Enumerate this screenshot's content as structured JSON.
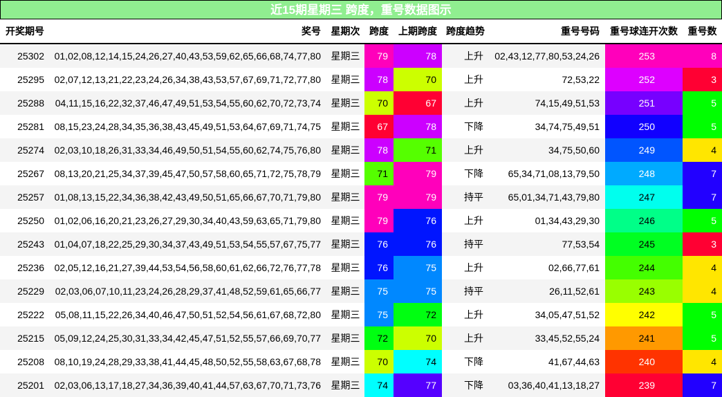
{
  "title": "近15期星期三 跨度，重号数据图示",
  "headers": [
    "开奖期号",
    "奖号",
    "星期次",
    "跨度",
    "上期跨度",
    "跨度趋势",
    "重号号码",
    "重号球连开次数",
    "重号数"
  ],
  "rows": [
    {
      "issue": "25302",
      "numbers": "01,02,08,12,14,15,24,26,27,40,43,53,59,62,65,66,68,74,77,80",
      "weekday": "星期三",
      "span": "79",
      "prev_span": "78",
      "trend": "上升",
      "repeat_numbers": "02,43,12,77,80,53,24,26",
      "streak": "253",
      "repeat_count": "8"
    },
    {
      "issue": "25295",
      "numbers": "02,07,12,13,21,22,23,24,26,34,38,43,53,57,67,69,71,72,77,80",
      "weekday": "星期三",
      "span": "78",
      "prev_span": "70",
      "trend": "上升",
      "repeat_numbers": "72,53,22",
      "streak": "252",
      "repeat_count": "3"
    },
    {
      "issue": "25288",
      "numbers": "04,11,15,16,22,32,37,46,47,49,51,53,54,55,60,62,70,72,73,74",
      "weekday": "星期三",
      "span": "70",
      "prev_span": "67",
      "trend": "上升",
      "repeat_numbers": "74,15,49,51,53",
      "streak": "251",
      "repeat_count": "5"
    },
    {
      "issue": "25281",
      "numbers": "08,15,23,24,28,34,35,36,38,43,45,49,51,53,64,67,69,71,74,75",
      "weekday": "星期三",
      "span": "67",
      "prev_span": "78",
      "trend": "下降",
      "repeat_numbers": "34,74,75,49,51",
      "streak": "250",
      "repeat_count": "5"
    },
    {
      "issue": "25274",
      "numbers": "02,03,10,18,26,31,33,34,46,49,50,51,54,55,60,62,74,75,76,80",
      "weekday": "星期三",
      "span": "78",
      "prev_span": "71",
      "trend": "上升",
      "repeat_numbers": "34,75,50,60",
      "streak": "249",
      "repeat_count": "4"
    },
    {
      "issue": "25267",
      "numbers": "08,13,20,21,25,34,37,39,45,47,50,57,58,60,65,71,72,75,78,79",
      "weekday": "星期三",
      "span": "71",
      "prev_span": "79",
      "trend": "下降",
      "repeat_numbers": "65,34,71,08,13,79,50",
      "streak": "248",
      "repeat_count": "7"
    },
    {
      "issue": "25257",
      "numbers": "01,08,13,15,22,34,36,38,42,43,49,50,51,65,66,67,70,71,79,80",
      "weekday": "星期三",
      "span": "79",
      "prev_span": "79",
      "trend": "持平",
      "repeat_numbers": "65,01,34,71,43,79,80",
      "streak": "247",
      "repeat_count": "7"
    },
    {
      "issue": "25250",
      "numbers": "01,02,06,16,20,21,23,26,27,29,30,34,40,43,59,63,65,71,79,80",
      "weekday": "星期三",
      "span": "79",
      "prev_span": "76",
      "trend": "上升",
      "repeat_numbers": "01,34,43,29,30",
      "streak": "246",
      "repeat_count": "5"
    },
    {
      "issue": "25243",
      "numbers": "01,04,07,18,22,25,29,30,34,37,43,49,51,53,54,55,57,67,75,77",
      "weekday": "星期三",
      "span": "76",
      "prev_span": "76",
      "trend": "持平",
      "repeat_numbers": "77,53,54",
      "streak": "245",
      "repeat_count": "3"
    },
    {
      "issue": "25236",
      "numbers": "02,05,12,16,21,27,39,44,53,54,56,58,60,61,62,66,72,76,77,78",
      "weekday": "星期三",
      "span": "76",
      "prev_span": "75",
      "trend": "上升",
      "repeat_numbers": "02,66,77,61",
      "streak": "244",
      "repeat_count": "4"
    },
    {
      "issue": "25229",
      "numbers": "02,03,06,07,10,11,23,24,26,28,29,37,41,48,52,59,61,65,66,77",
      "weekday": "星期三",
      "span": "75",
      "prev_span": "75",
      "trend": "持平",
      "repeat_numbers": "26,11,52,61",
      "streak": "243",
      "repeat_count": "4"
    },
    {
      "issue": "25222",
      "numbers": "05,08,11,15,22,26,34,40,46,47,50,51,52,54,56,61,67,68,72,80",
      "weekday": "星期三",
      "span": "75",
      "prev_span": "72",
      "trend": "上升",
      "repeat_numbers": "34,05,47,51,52",
      "streak": "242",
      "repeat_count": "5"
    },
    {
      "issue": "25215",
      "numbers": "05,09,12,24,25,30,31,33,34,42,45,47,51,52,55,57,66,69,70,77",
      "weekday": "星期三",
      "span": "72",
      "prev_span": "70",
      "trend": "上升",
      "repeat_numbers": "33,45,52,55,24",
      "streak": "241",
      "repeat_count": "5"
    },
    {
      "issue": "25208",
      "numbers": "08,10,19,24,28,29,33,38,41,44,45,48,50,52,55,58,63,67,68,78",
      "weekday": "星期三",
      "span": "70",
      "prev_span": "74",
      "trend": "下降",
      "repeat_numbers": "41,67,44,63",
      "streak": "240",
      "repeat_count": "4"
    },
    {
      "issue": "25201",
      "numbers": "02,03,06,13,17,18,27,34,36,39,40,41,44,57,63,67,70,71,73,76",
      "weekday": "星期三",
      "span": "74",
      "prev_span": "77",
      "trend": "下降",
      "repeat_numbers": "03,36,40,41,13,18,27",
      "streak": "239",
      "repeat_count": "7"
    }
  ],
  "colors": {
    "title_bg": "#90ee90",
    "span": {
      "67": "#ff0033",
      "70": "#ccff00",
      "71": "#55ff00",
      "72": "#00ff11",
      "74": "#00ffff",
      "75": "#0088ff",
      "76": "#0015ff",
      "77": "#5500ff",
      "78": "#cc00ff",
      "79": "#ff00bb"
    },
    "streak": {
      "239": "#ff0033",
      "240": "#ff3300",
      "241": "#ff9900",
      "242": "#ffff00",
      "243": "#99ff00",
      "244": "#44ff00",
      "245": "#00ff22",
      "246": "#00ff88",
      "247": "#00ffee",
      "248": "#00aaff",
      "249": "#0055ff",
      "250": "#1100ff",
      "251": "#7700ff",
      "252": "#dd00ff",
      "253": "#ff00bb"
    },
    "repeat_count": {
      "3": "#ff0033",
      "4": "#ffe600",
      "5": "#00ff00",
      "7": "#2200ff",
      "8": "#ff00bb"
    }
  }
}
